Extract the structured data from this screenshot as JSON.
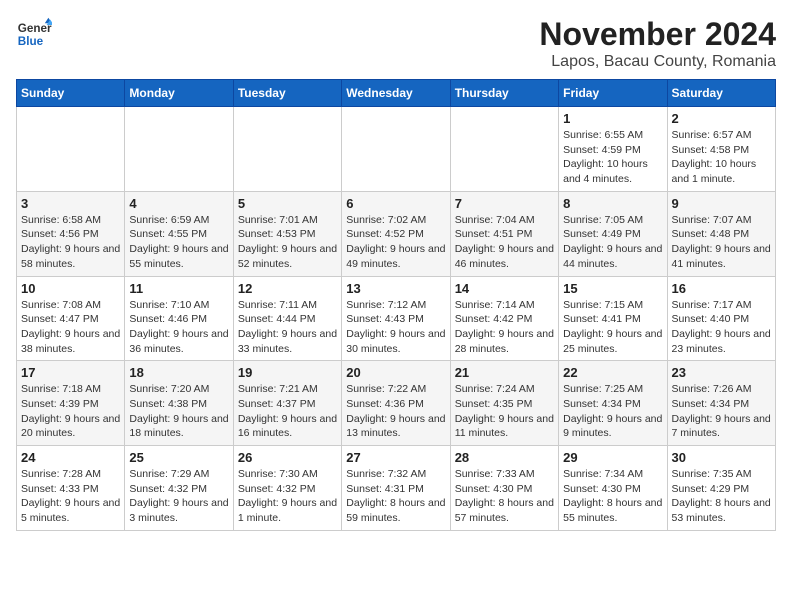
{
  "logo": {
    "text_general": "General",
    "text_blue": "Blue"
  },
  "title": "November 2024",
  "subtitle": "Lapos, Bacau County, Romania",
  "weekdays": [
    "Sunday",
    "Monday",
    "Tuesday",
    "Wednesday",
    "Thursday",
    "Friday",
    "Saturday"
  ],
  "weeks": [
    [
      {
        "day": "",
        "info": ""
      },
      {
        "day": "",
        "info": ""
      },
      {
        "day": "",
        "info": ""
      },
      {
        "day": "",
        "info": ""
      },
      {
        "day": "",
        "info": ""
      },
      {
        "day": "1",
        "info": "Sunrise: 6:55 AM\nSunset: 4:59 PM\nDaylight: 10 hours and 4 minutes."
      },
      {
        "day": "2",
        "info": "Sunrise: 6:57 AM\nSunset: 4:58 PM\nDaylight: 10 hours and 1 minute."
      }
    ],
    [
      {
        "day": "3",
        "info": "Sunrise: 6:58 AM\nSunset: 4:56 PM\nDaylight: 9 hours and 58 minutes."
      },
      {
        "day": "4",
        "info": "Sunrise: 6:59 AM\nSunset: 4:55 PM\nDaylight: 9 hours and 55 minutes."
      },
      {
        "day": "5",
        "info": "Sunrise: 7:01 AM\nSunset: 4:53 PM\nDaylight: 9 hours and 52 minutes."
      },
      {
        "day": "6",
        "info": "Sunrise: 7:02 AM\nSunset: 4:52 PM\nDaylight: 9 hours and 49 minutes."
      },
      {
        "day": "7",
        "info": "Sunrise: 7:04 AM\nSunset: 4:51 PM\nDaylight: 9 hours and 46 minutes."
      },
      {
        "day": "8",
        "info": "Sunrise: 7:05 AM\nSunset: 4:49 PM\nDaylight: 9 hours and 44 minutes."
      },
      {
        "day": "9",
        "info": "Sunrise: 7:07 AM\nSunset: 4:48 PM\nDaylight: 9 hours and 41 minutes."
      }
    ],
    [
      {
        "day": "10",
        "info": "Sunrise: 7:08 AM\nSunset: 4:47 PM\nDaylight: 9 hours and 38 minutes."
      },
      {
        "day": "11",
        "info": "Sunrise: 7:10 AM\nSunset: 4:46 PM\nDaylight: 9 hours and 36 minutes."
      },
      {
        "day": "12",
        "info": "Sunrise: 7:11 AM\nSunset: 4:44 PM\nDaylight: 9 hours and 33 minutes."
      },
      {
        "day": "13",
        "info": "Sunrise: 7:12 AM\nSunset: 4:43 PM\nDaylight: 9 hours and 30 minutes."
      },
      {
        "day": "14",
        "info": "Sunrise: 7:14 AM\nSunset: 4:42 PM\nDaylight: 9 hours and 28 minutes."
      },
      {
        "day": "15",
        "info": "Sunrise: 7:15 AM\nSunset: 4:41 PM\nDaylight: 9 hours and 25 minutes."
      },
      {
        "day": "16",
        "info": "Sunrise: 7:17 AM\nSunset: 4:40 PM\nDaylight: 9 hours and 23 minutes."
      }
    ],
    [
      {
        "day": "17",
        "info": "Sunrise: 7:18 AM\nSunset: 4:39 PM\nDaylight: 9 hours and 20 minutes."
      },
      {
        "day": "18",
        "info": "Sunrise: 7:20 AM\nSunset: 4:38 PM\nDaylight: 9 hours and 18 minutes."
      },
      {
        "day": "19",
        "info": "Sunrise: 7:21 AM\nSunset: 4:37 PM\nDaylight: 9 hours and 16 minutes."
      },
      {
        "day": "20",
        "info": "Sunrise: 7:22 AM\nSunset: 4:36 PM\nDaylight: 9 hours and 13 minutes."
      },
      {
        "day": "21",
        "info": "Sunrise: 7:24 AM\nSunset: 4:35 PM\nDaylight: 9 hours and 11 minutes."
      },
      {
        "day": "22",
        "info": "Sunrise: 7:25 AM\nSunset: 4:34 PM\nDaylight: 9 hours and 9 minutes."
      },
      {
        "day": "23",
        "info": "Sunrise: 7:26 AM\nSunset: 4:34 PM\nDaylight: 9 hours and 7 minutes."
      }
    ],
    [
      {
        "day": "24",
        "info": "Sunrise: 7:28 AM\nSunset: 4:33 PM\nDaylight: 9 hours and 5 minutes."
      },
      {
        "day": "25",
        "info": "Sunrise: 7:29 AM\nSunset: 4:32 PM\nDaylight: 9 hours and 3 minutes."
      },
      {
        "day": "26",
        "info": "Sunrise: 7:30 AM\nSunset: 4:32 PM\nDaylight: 9 hours and 1 minute."
      },
      {
        "day": "27",
        "info": "Sunrise: 7:32 AM\nSunset: 4:31 PM\nDaylight: 8 hours and 59 minutes."
      },
      {
        "day": "28",
        "info": "Sunrise: 7:33 AM\nSunset: 4:30 PM\nDaylight: 8 hours and 57 minutes."
      },
      {
        "day": "29",
        "info": "Sunrise: 7:34 AM\nSunset: 4:30 PM\nDaylight: 8 hours and 55 minutes."
      },
      {
        "day": "30",
        "info": "Sunrise: 7:35 AM\nSunset: 4:29 PM\nDaylight: 8 hours and 53 minutes."
      }
    ]
  ]
}
